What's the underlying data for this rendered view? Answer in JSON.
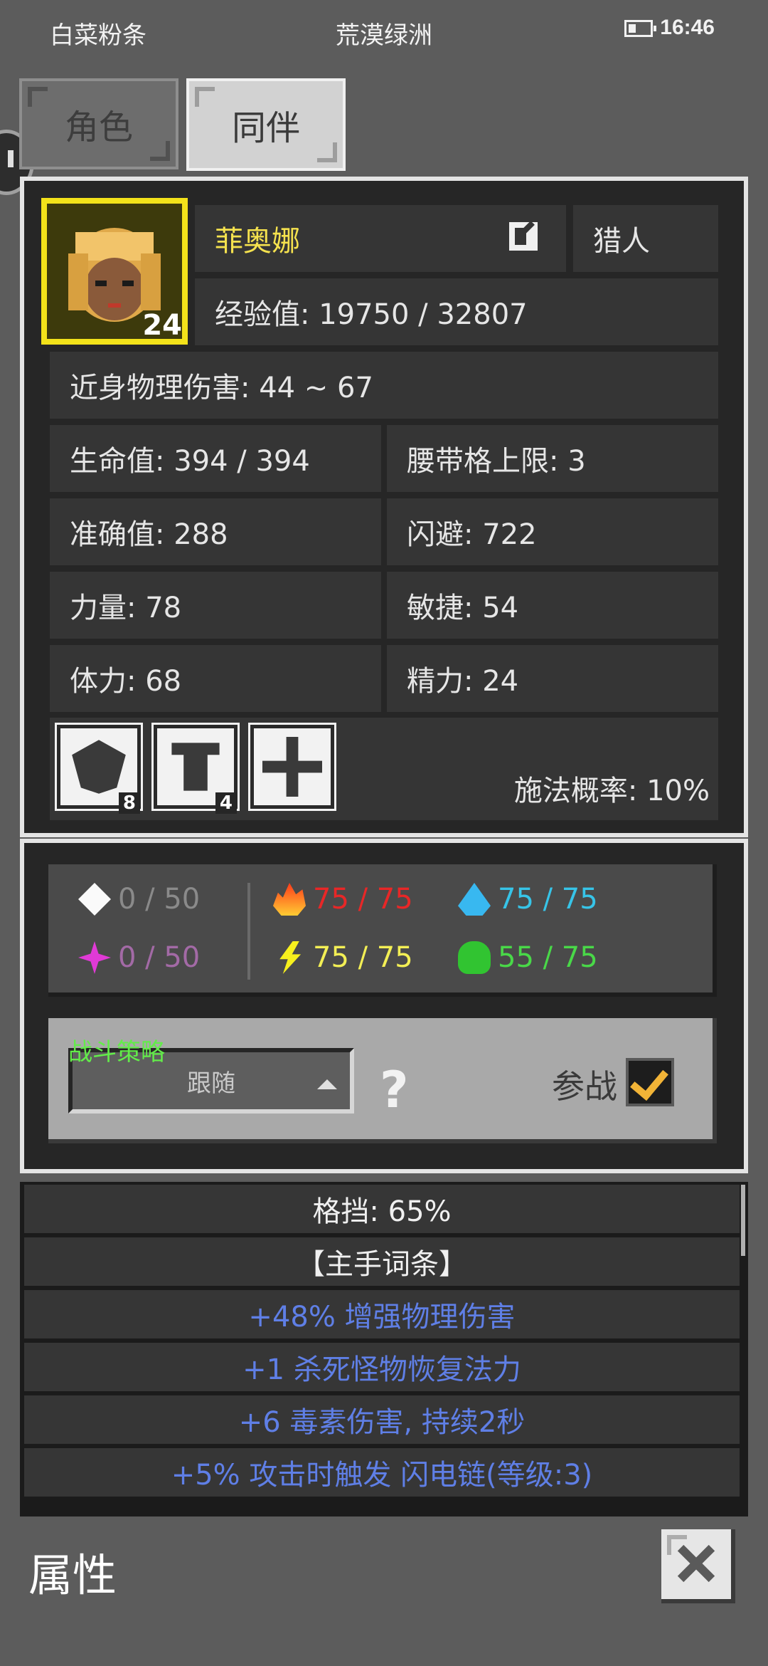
{
  "status_bar": {
    "left": "白菜粉条",
    "center": "荒漠绿洲",
    "time": "16:46",
    "battery_icon": "battery-icon"
  },
  "tabs": [
    {
      "label": "角色",
      "selected": false
    },
    {
      "label": "同伴",
      "selected": true
    }
  ],
  "companion": {
    "name": "菲奥娜",
    "level": "24",
    "class": "猎人",
    "experience": "经验值: 19750 / 32807",
    "melee_damage": "近身物理伤害: 44 ~ 67",
    "stats": [
      {
        "left": "生命值: 394 / 394",
        "right": "腰带格上限: 3"
      },
      {
        "left": "准确值: 288",
        "right": "闪避: 722"
      },
      {
        "left": "力量: 78",
        "right": "敏捷: 54"
      },
      {
        "left": "体力: 68",
        "right": "精力: 24"
      }
    ],
    "skills": [
      {
        "icon": "shield-icon",
        "count": "8"
      },
      {
        "icon": "pillar-icon",
        "count": "4"
      },
      {
        "icon": "cross-arrows-icon",
        "count": ""
      }
    ],
    "cast_rate": "施法概率: 10%"
  },
  "resistances": {
    "physical": "0 / 50",
    "magic": "0 / 50",
    "fire": "75 / 75",
    "lightning": "75 / 75",
    "cold": "75 / 75",
    "poison": "55 / 75"
  },
  "colors": {
    "fire": "#e82727",
    "lightning": "#f3ef55",
    "cold": "#37c4e8",
    "poison": "#49d848",
    "name": "#f5e24e",
    "affix": "#5f7fe6",
    "tactics": "#63ec4a"
  },
  "tactics": {
    "label": "战斗策略",
    "selected": "跟随",
    "help": "?",
    "join_label": "参战",
    "join_checked": true
  },
  "item_lines": [
    {
      "text": "格挡: 65%",
      "style": "white"
    },
    {
      "text": "【主手词条】",
      "style": "white"
    },
    {
      "text": "+48% 增强物理伤害",
      "style": "blue"
    },
    {
      "text": "+1 杀死怪物恢复法力",
      "style": "blue"
    },
    {
      "text": "+6 毒素伤害, 持续2秒",
      "style": "blue"
    },
    {
      "text": "+5% 攻击时触发 闪电链(等级:3)",
      "style": "blue"
    }
  ],
  "footer": {
    "title": "属性"
  }
}
